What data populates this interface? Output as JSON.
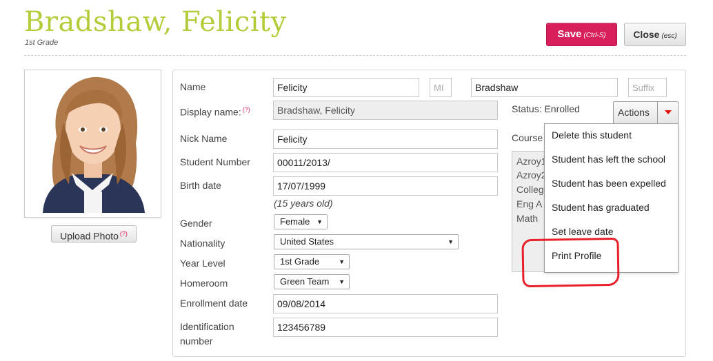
{
  "header": {
    "title": "Bradshaw, Felicity",
    "subtitle": "1st Grade",
    "save_label": "Save",
    "save_hint": "(Ctrl-S)",
    "close_label": "Close",
    "close_hint": "(esc)"
  },
  "photo": {
    "upload_label": "Upload Photo",
    "help_marker": "(?)"
  },
  "form": {
    "name_label": "Name",
    "first_name": "Felicity",
    "middle_placeholder": "MI",
    "last_name": "Bradshaw",
    "suffix_placeholder": "Suffix",
    "display_name_label": "Display name:",
    "display_name_help": "(?)",
    "display_name": "Bradshaw, Felicity",
    "nick_name_label": "Nick Name",
    "nick_name": "Felicity",
    "student_number_label": "Student Number",
    "student_number": "00011/2013/",
    "birth_date_label": "Birth date",
    "birth_date": "17/07/1999",
    "age_text": "(15 years old)",
    "gender_label": "Gender",
    "gender": "Female",
    "nationality_label": "Nationality",
    "nationality": "United States",
    "year_level_label": "Year Level",
    "year_level": "1st Grade",
    "homeroom_label": "Homeroom",
    "homeroom": "Green Team",
    "enrollment_label": "Enrollment date",
    "enrollment_date": "09/08/2014",
    "identification_label_1": "Identification",
    "identification_label_2": "number",
    "identification": "123456789"
  },
  "status": {
    "text": "Status: Enrolled",
    "actions_label": "Actions",
    "courses_label": "Course",
    "courses": [
      "Azroy1",
      "Azroy2",
      "Colleg",
      "Eng  A",
      "Math  "
    ]
  },
  "actions_menu": {
    "items": [
      "Delete this student",
      "Student has left the school",
      "Student has been expelled",
      "Student has graduated",
      "Set leave date",
      "Print Profile"
    ]
  },
  "colors": {
    "title": "#b5cc3a",
    "save_button": "#d81e5b",
    "help_marker": "#d81e5b",
    "annotation": "#e8202a",
    "actions_caret": "#e3120b"
  }
}
